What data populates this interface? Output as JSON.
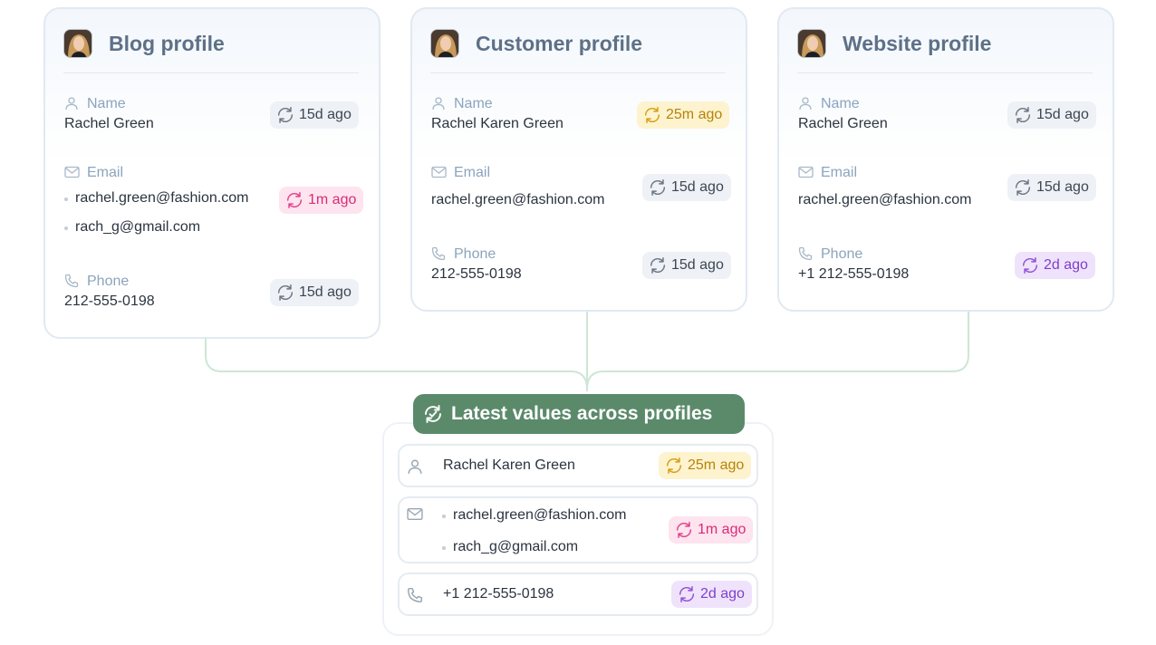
{
  "profiles": [
    {
      "title": "Blog profile",
      "name_label": "Name",
      "name_value": "Rachel Green",
      "name_updated": "15d ago",
      "email_label": "Email",
      "emails": [
        "rachel.green@fashion.com",
        "rach_g@gmail.com"
      ],
      "email_updated": "1m ago",
      "phone_label": "Phone",
      "phone_value": "212-555-0198",
      "phone_updated": "15d ago"
    },
    {
      "title": "Customer profile",
      "name_label": "Name",
      "name_value": "Rachel Karen Green",
      "name_updated": "25m ago",
      "email_label": "Email",
      "emails": [
        "rachel.green@fashion.com"
      ],
      "email_updated": "15d ago",
      "phone_label": "Phone",
      "phone_value": "212-555-0198",
      "phone_updated": "15d ago"
    },
    {
      "title": "Website profile",
      "name_label": "Name",
      "name_value": "Rachel Green",
      "name_updated": "15d ago",
      "email_label": "Email",
      "emails": [
        "rachel.green@fashion.com"
      ],
      "email_updated": "15d ago",
      "phone_label": "Phone",
      "phone_value": "+1 212-555-0198",
      "phone_updated": "2d ago"
    }
  ],
  "merged": {
    "title": "Latest values across profiles",
    "name_value": "Rachel Karen Green",
    "name_updated": "25m ago",
    "emails": [
      "rachel.green@fashion.com",
      "rach_g@gmail.com"
    ],
    "email_updated": "1m ago",
    "phone_value": "+1 212-555-0198",
    "phone_updated": "2d ago"
  },
  "colors": {
    "badge_gray": "#eef1f5",
    "badge_yellow": "#fdf3cf",
    "badge_pink": "#fde4ee",
    "badge_purple": "#efe3fb",
    "merge_green": "#5b8a6b",
    "connector": "#cfe6d6"
  },
  "icons": {
    "field_name": "person-icon",
    "field_email": "envelope-icon",
    "field_phone": "phone-icon",
    "badge": "sync-icon",
    "merge": "sync-icon"
  }
}
